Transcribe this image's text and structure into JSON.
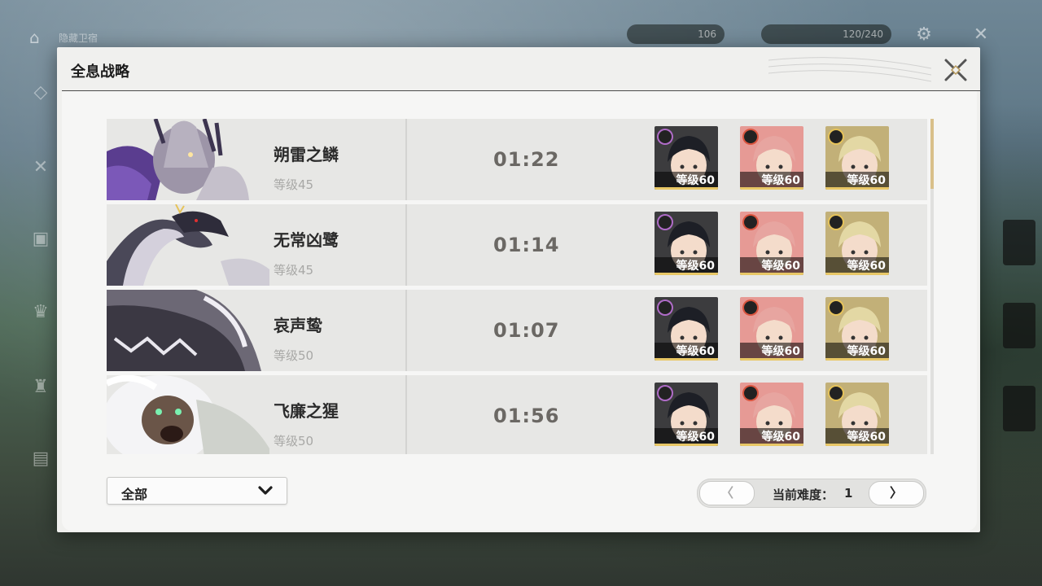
{
  "hud": {
    "title": "隐藏卫宿",
    "currency1": "106",
    "currency2": "120/240"
  },
  "modal": {
    "title": "全息战略"
  },
  "bosses": [
    {
      "name": "朔雷之鳞",
      "level": "等级45",
      "time": "01:22",
      "team": [
        {
          "level": "等级60",
          "element": "electro"
        },
        {
          "level": "等级60",
          "element": "fusion"
        },
        {
          "level": "等级60",
          "element": "spectro"
        }
      ]
    },
    {
      "name": "无常凶鹭",
      "level": "等级45",
      "time": "01:14",
      "team": [
        {
          "level": "等级60",
          "element": "electro"
        },
        {
          "level": "等级60",
          "element": "fusion"
        },
        {
          "level": "等级60",
          "element": "spectro"
        }
      ]
    },
    {
      "name": "哀声鸷",
      "level": "等级50",
      "time": "01:07",
      "team": [
        {
          "level": "等级60",
          "element": "electro"
        },
        {
          "level": "等级60",
          "element": "fusion"
        },
        {
          "level": "等级60",
          "element": "spectro"
        }
      ]
    },
    {
      "name": "飞廉之猩",
      "level": "等级50",
      "time": "01:56",
      "team": [
        {
          "level": "等级60",
          "element": "electro"
        },
        {
          "level": "等级60",
          "element": "fusion"
        },
        {
          "level": "等级60",
          "element": "spectro"
        }
      ]
    }
  ],
  "filter": {
    "label": "全部"
  },
  "pager": {
    "prev": "〈",
    "next": "〉",
    "label": "当前难度：",
    "value": "1"
  },
  "colors": {
    "accent": "#d9c08a",
    "level_bar": "#e8c766",
    "electro": "#b06cc8",
    "fusion": "#d9553f",
    "spectro": "#e6c35a"
  }
}
